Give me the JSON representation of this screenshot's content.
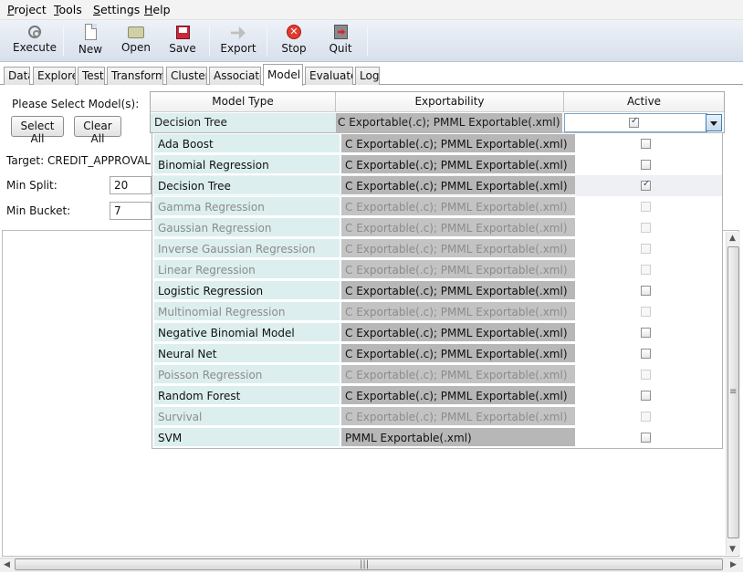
{
  "menu": [
    {
      "u": "P",
      "rest": "roject"
    },
    {
      "u": "T",
      "rest": "ools"
    },
    {
      "u": "S",
      "rest": "ettings"
    },
    {
      "u": "H",
      "rest": "elp"
    }
  ],
  "toolbar": {
    "execute": "Execute",
    "new": "New",
    "open": "Open",
    "save": "Save",
    "export": "Export",
    "stop": "Stop",
    "quit": "Quit",
    "stop_glyph": "✕"
  },
  "tabs": [
    "Data",
    "Explore",
    "Test",
    "Transform",
    "Cluster",
    "Associate",
    "Model",
    "Evaluate",
    "Log"
  ],
  "active_tab": "Model",
  "left": {
    "select_prompt": "Please Select Model(s):",
    "select_all": "Select All",
    "clear_all": "Clear All",
    "target": "Target: CREDIT_APPROVAL",
    "min_split_label": "Min Split:",
    "min_split_value": "20",
    "min_bucket_label": "Min Bucket:",
    "min_bucket_value": "7"
  },
  "table": {
    "headers": [
      "Model Type",
      "Exportability",
      "Active"
    ],
    "selected": {
      "type": "Decision Tree",
      "exportability": "C Exportable(.c); PMML Exportable(.xml)",
      "active": true
    }
  },
  "models": [
    {
      "type": "Ada Boost",
      "exportability": "C Exportable(.c); PMML Exportable(.xml)",
      "active": false,
      "enabled": true
    },
    {
      "type": "Binomial Regression",
      "exportability": "C Exportable(.c); PMML Exportable(.xml)",
      "active": false,
      "enabled": true
    },
    {
      "type": "Decision Tree",
      "exportability": "C Exportable(.c); PMML Exportable(.xml)",
      "active": true,
      "enabled": true
    },
    {
      "type": "Gamma Regression",
      "exportability": "C Exportable(.c); PMML Exportable(.xml)",
      "active": false,
      "enabled": false
    },
    {
      "type": "Gaussian Regression",
      "exportability": "C Exportable(.c); PMML Exportable(.xml)",
      "active": false,
      "enabled": false
    },
    {
      "type": "Inverse Gaussian Regression",
      "exportability": "C Exportable(.c); PMML Exportable(.xml)",
      "active": false,
      "enabled": false
    },
    {
      "type": "Linear Regression",
      "exportability": "C Exportable(.c); PMML Exportable(.xml)",
      "active": false,
      "enabled": false
    },
    {
      "type": "Logistic Regression",
      "exportability": "C Exportable(.c); PMML Exportable(.xml)",
      "active": false,
      "enabled": true
    },
    {
      "type": "Multinomial Regression",
      "exportability": "C Exportable(.c); PMML Exportable(.xml)",
      "active": false,
      "enabled": false
    },
    {
      "type": "Negative Binomial Model",
      "exportability": "C Exportable(.c); PMML Exportable(.xml)",
      "active": false,
      "enabled": true
    },
    {
      "type": "Neural Net",
      "exportability": "C Exportable(.c); PMML Exportable(.xml)",
      "active": false,
      "enabled": true
    },
    {
      "type": "Poisson Regression",
      "exportability": "C Exportable(.c); PMML Exportable(.xml)",
      "active": false,
      "enabled": false
    },
    {
      "type": "Random Forest",
      "exportability": "C Exportable(.c); PMML Exportable(.xml)",
      "active": false,
      "enabled": true
    },
    {
      "type": "Survival",
      "exportability": "C Exportable(.c); PMML Exportable(.xml)",
      "active": false,
      "enabled": false
    },
    {
      "type": "SVM",
      "exportability": "PMML Exportable(.xml)",
      "active": false,
      "enabled": true
    }
  ]
}
